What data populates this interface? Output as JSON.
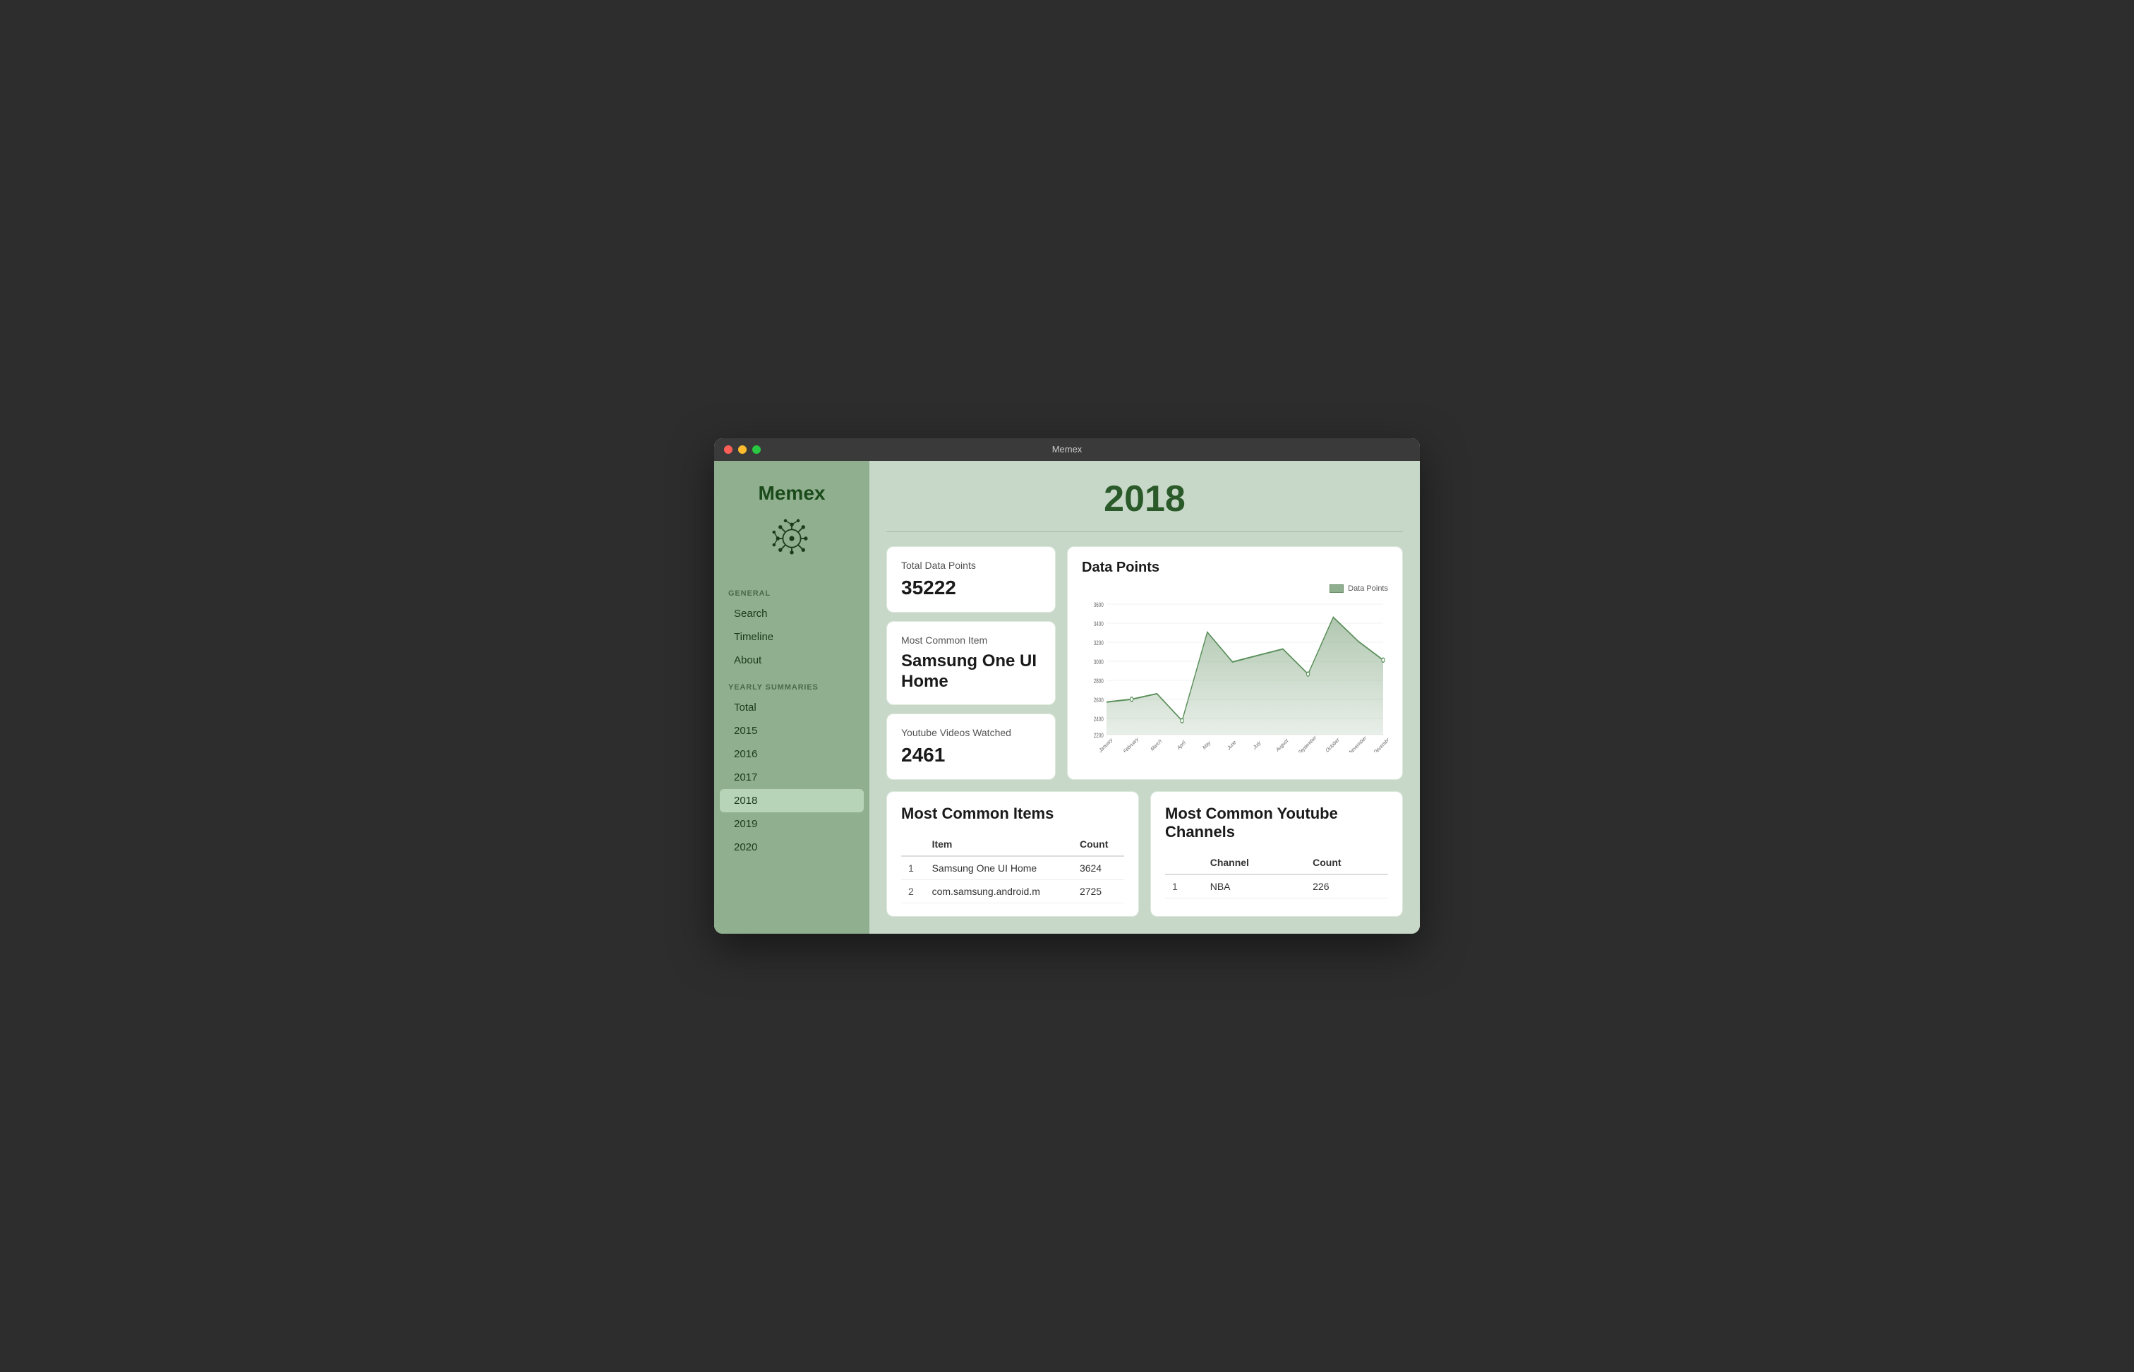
{
  "window": {
    "title": "Memex"
  },
  "sidebar": {
    "app_title": "Memex",
    "sections": [
      {
        "label": "GENERAL",
        "items": [
          {
            "id": "search",
            "label": "Search",
            "active": false
          },
          {
            "id": "timeline",
            "label": "Timeline",
            "active": false
          },
          {
            "id": "about",
            "label": "About",
            "active": false
          }
        ]
      },
      {
        "label": "YEARLY SUMMARIES",
        "items": [
          {
            "id": "total",
            "label": "Total",
            "active": false
          },
          {
            "id": "2015",
            "label": "2015",
            "active": false
          },
          {
            "id": "2016",
            "label": "2016",
            "active": false
          },
          {
            "id": "2017",
            "label": "2017",
            "active": false
          },
          {
            "id": "2018",
            "label": "2018",
            "active": true
          },
          {
            "id": "2019",
            "label": "2019",
            "active": false
          },
          {
            "id": "2020",
            "label": "2020",
            "active": false
          }
        ]
      }
    ]
  },
  "main": {
    "year_title": "2018",
    "stats": {
      "total_data_points_label": "Total Data Points",
      "total_data_points_value": "35222",
      "most_common_item_label": "Most Common Item",
      "most_common_item_value": "Samsung One UI Home",
      "youtube_watched_label": "Youtube Videos Watched",
      "youtube_watched_value": "2461"
    },
    "chart": {
      "title": "Data Points",
      "legend_label": "Data Points",
      "months": [
        "January",
        "February",
        "March",
        "April",
        "May",
        "June",
        "July",
        "August",
        "September",
        "October",
        "November",
        "December"
      ],
      "values": [
        2550,
        2580,
        2640,
        2350,
        3300,
        2980,
        3050,
        3120,
        2850,
        3460,
        3200,
        3000
      ],
      "y_min": 2200,
      "y_max": 3600
    },
    "most_common_items": {
      "title": "Most Common Items",
      "columns": [
        "",
        "Item",
        "Count"
      ],
      "rows": [
        {
          "rank": "1",
          "item": "Samsung One UI Home",
          "count": "3624"
        },
        {
          "rank": "2",
          "item": "com.samsung.android.m",
          "count": "2725"
        }
      ]
    },
    "most_common_channels": {
      "title": "Most Common Youtube Channels",
      "columns": [
        "",
        "Channel",
        "Count"
      ],
      "rows": [
        {
          "rank": "1",
          "channel": "NBA",
          "count": "226"
        }
      ]
    }
  }
}
